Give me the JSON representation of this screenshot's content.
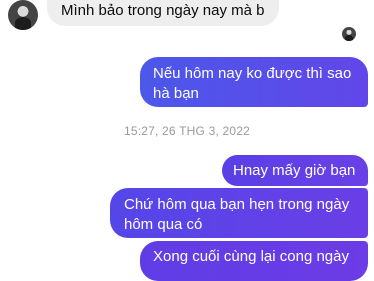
{
  "messages": {
    "incoming_1": "Mình bảo trong ngày nay mà b",
    "outgoing_1": "Nếu hôm nay ko được thì sao hà bạn",
    "timestamp": "15:27, 26 THG 3, 2022",
    "outgoing_2": "Hnay mấy giờ bạn",
    "outgoing_3": "Chứ hôm qua bạn hẹn trong ngày hôm qua có",
    "outgoing_4": "Xong cuối cùng lại cong ngày"
  },
  "colors": {
    "incoming_bubble": "#eeeeef",
    "outgoing_bubble_start": "#4b58ea",
    "outgoing_bubble_end": "#6c3ce6",
    "timestamp_text": "#9a9a9f"
  }
}
